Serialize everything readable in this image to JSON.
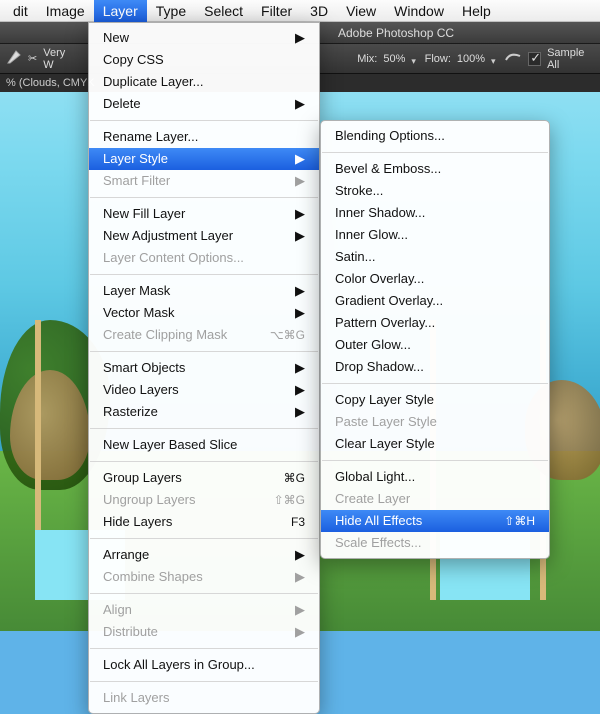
{
  "menubar": {
    "items": [
      "dit",
      "Image",
      "Layer",
      "Type",
      "Select",
      "Filter",
      "3D",
      "View",
      "Window",
      "Help"
    ],
    "active_index": 2
  },
  "app_title": "Adobe Photoshop CC",
  "toolbar": {
    "very_label": "Very W",
    "mix_label": "Mix:",
    "mix_value": "50%",
    "flow_label": "Flow:",
    "flow_value": "100%",
    "sample_all": "Sample All"
  },
  "tab_label": "% (Clouds, CMYK",
  "layer_menu": {
    "items": [
      {
        "label": "New",
        "sub": true
      },
      {
        "label": "Copy CSS"
      },
      {
        "label": "Duplicate Layer..."
      },
      {
        "label": "Delete",
        "sub": true
      },
      {
        "sep": true
      },
      {
        "label": "Rename Layer..."
      },
      {
        "label": "Layer Style",
        "sub": true,
        "selected": true
      },
      {
        "label": "Smart Filter",
        "sub": true,
        "disabled": true
      },
      {
        "sep": true
      },
      {
        "label": "New Fill Layer",
        "sub": true
      },
      {
        "label": "New Adjustment Layer",
        "sub": true
      },
      {
        "label": "Layer Content Options...",
        "disabled": true
      },
      {
        "sep": true
      },
      {
        "label": "Layer Mask",
        "sub": true
      },
      {
        "label": "Vector Mask",
        "sub": true
      },
      {
        "label": "Create Clipping Mask",
        "shortcut": "⌥⌘G",
        "disabled": true
      },
      {
        "sep": true
      },
      {
        "label": "Smart Objects",
        "sub": true
      },
      {
        "label": "Video Layers",
        "sub": true
      },
      {
        "label": "Rasterize",
        "sub": true
      },
      {
        "sep": true
      },
      {
        "label": "New Layer Based Slice"
      },
      {
        "sep": true
      },
      {
        "label": "Group Layers",
        "shortcut": "⌘G"
      },
      {
        "label": "Ungroup Layers",
        "shortcut": "⇧⌘G",
        "disabled": true
      },
      {
        "label": "Hide Layers",
        "shortcut": "F3"
      },
      {
        "sep": true
      },
      {
        "label": "Arrange",
        "sub": true
      },
      {
        "label": "Combine Shapes",
        "sub": true,
        "disabled": true
      },
      {
        "sep": true
      },
      {
        "label": "Align",
        "sub": true,
        "disabled": true
      },
      {
        "label": "Distribute",
        "sub": true,
        "disabled": true
      },
      {
        "sep": true
      },
      {
        "label": "Lock All Layers in Group..."
      },
      {
        "sep": true
      },
      {
        "label": "Link Layers",
        "disabled": true
      }
    ]
  },
  "style_submenu": {
    "items": [
      {
        "label": "Blending Options..."
      },
      {
        "sep": true
      },
      {
        "label": "Bevel & Emboss..."
      },
      {
        "label": "Stroke..."
      },
      {
        "label": "Inner Shadow..."
      },
      {
        "label": "Inner Glow..."
      },
      {
        "label": "Satin..."
      },
      {
        "label": "Color Overlay..."
      },
      {
        "label": "Gradient Overlay..."
      },
      {
        "label": "Pattern Overlay..."
      },
      {
        "label": "Outer Glow..."
      },
      {
        "label": "Drop Shadow..."
      },
      {
        "sep": true
      },
      {
        "label": "Copy Layer Style"
      },
      {
        "label": "Paste Layer Style",
        "disabled": true
      },
      {
        "label": "Clear Layer Style"
      },
      {
        "sep": true
      },
      {
        "label": "Global Light..."
      },
      {
        "label": "Create Layer",
        "disabled": true
      },
      {
        "label": "Hide All Effects",
        "shortcut": "⇧⌘H",
        "selected": true
      },
      {
        "label": "Scale Effects...",
        "disabled": true
      }
    ]
  }
}
